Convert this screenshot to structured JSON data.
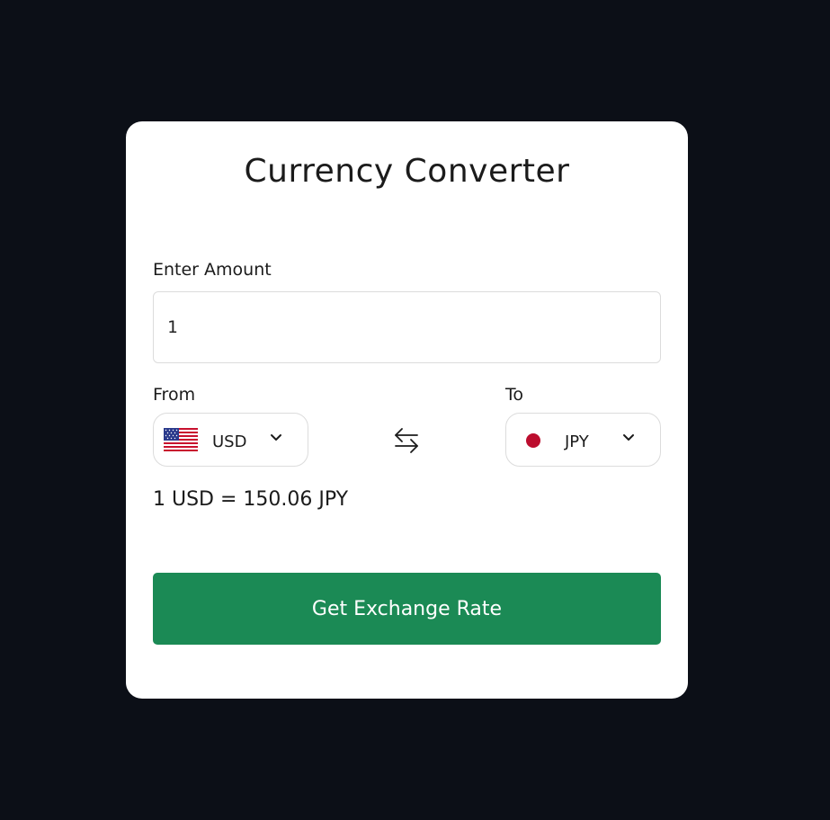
{
  "app": {
    "title": "Currency Converter"
  },
  "amount": {
    "label": "Enter Amount",
    "value": "1"
  },
  "from": {
    "label": "From",
    "currency": "USD",
    "flag_icon": "us-flag-icon"
  },
  "to": {
    "label": "To",
    "currency": "JPY",
    "flag_icon": "jp-flag-icon"
  },
  "swap_icon": "swap-arrows-icon",
  "result": {
    "text": "1 USD = 150.06 JPY"
  },
  "action": {
    "button_label": "Get Exchange Rate"
  },
  "colors": {
    "background": "#0c0f17",
    "card": "#ffffff",
    "button": "#1b8a55",
    "jp_red": "#bc0d2e"
  }
}
